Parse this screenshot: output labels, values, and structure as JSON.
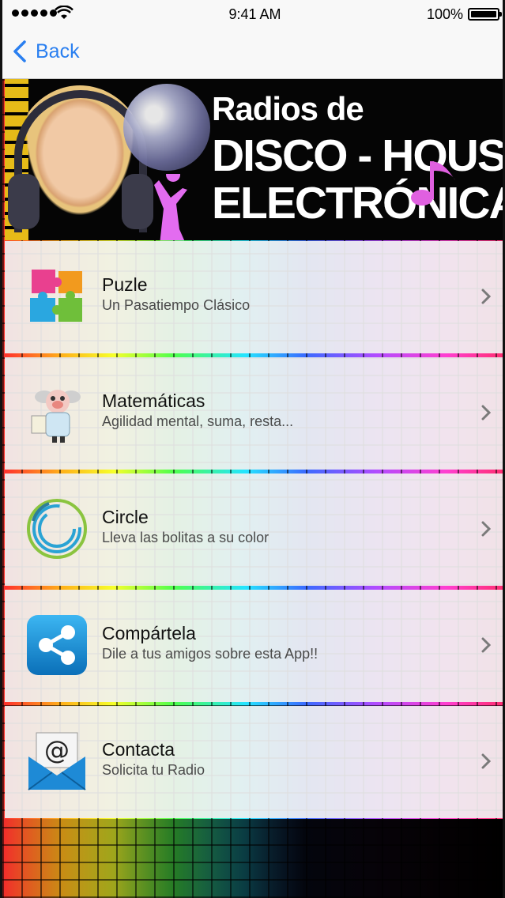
{
  "status_bar": {
    "time": "9:41 AM",
    "battery": "100%"
  },
  "nav": {
    "back_label": "Back"
  },
  "banner": {
    "line1": "Radios de",
    "line2": "DISCO - HOUSE",
    "line3": "ELECTRÓNICA"
  },
  "menu": [
    {
      "title": "Puzle",
      "subtitle": "Un Pasatiempo Clásico",
      "icon": "puzzle-icon"
    },
    {
      "title": "Matemáticas",
      "subtitle": "Agilidad mental, suma, resta...",
      "icon": "professor-icon"
    },
    {
      "title": "Circle",
      "subtitle": "Lleva las bolitas a su color",
      "icon": "circle-game-icon"
    },
    {
      "title": "Compártela",
      "subtitle": "Dile a tus amigos sobre esta App!!",
      "icon": "share-icon"
    },
    {
      "title": "Contacta",
      "subtitle": "Solicita tu Radio",
      "icon": "email-icon"
    }
  ],
  "colors": {
    "accent": "#2a7ff0",
    "row_bg": "#f0f0f0",
    "banner_bg": "#050505"
  }
}
